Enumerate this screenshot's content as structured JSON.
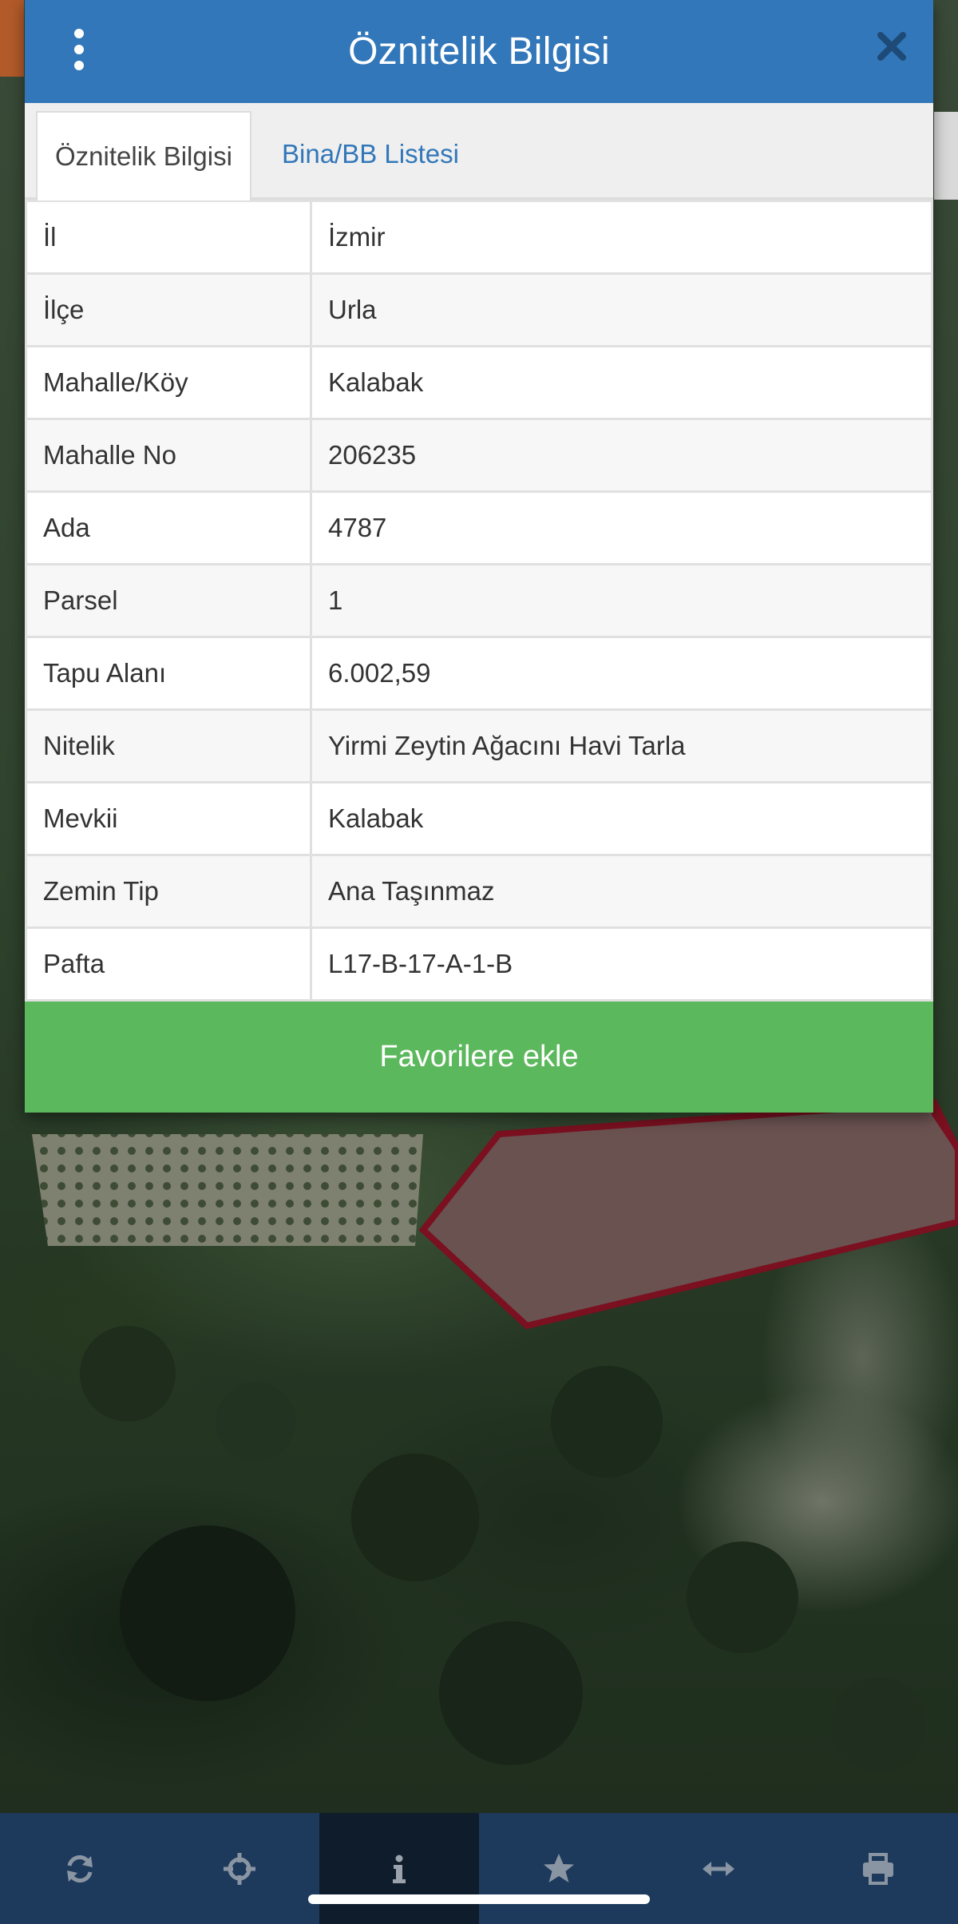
{
  "dialog": {
    "title": "Öznitelik Bilgisi",
    "tabs": [
      {
        "label": "Öznitelik Bilgisi",
        "active": true
      },
      {
        "label": "Bina/BB Listesi",
        "active": false
      }
    ],
    "rows": [
      {
        "key": "İl",
        "value": "İzmir"
      },
      {
        "key": "İlçe",
        "value": "Urla"
      },
      {
        "key": "Mahalle/Köy",
        "value": "Kalabak"
      },
      {
        "key": "Mahalle No",
        "value": "206235"
      },
      {
        "key": "Ada",
        "value": "4787"
      },
      {
        "key": "Parsel",
        "value": "1"
      },
      {
        "key": "Tapu Alanı",
        "value": "6.002,59"
      },
      {
        "key": "Nitelik",
        "value": "Yirmi Zeytin Ağacını Havi Tarla"
      },
      {
        "key": "Mevkii",
        "value": "Kalabak"
      },
      {
        "key": "Zemin Tip",
        "value": "Ana Taşınmaz"
      },
      {
        "key": "Pafta",
        "value": "L17-B-17-A-1-B"
      }
    ],
    "favorite_button": "Favorilere ekle"
  },
  "toolbar": {
    "items": [
      {
        "icon": "refresh-icon",
        "active": false
      },
      {
        "icon": "crosshair-icon",
        "active": false
      },
      {
        "icon": "info-icon",
        "active": true
      },
      {
        "icon": "star-icon",
        "active": false
      },
      {
        "icon": "measure-icon",
        "active": false
      },
      {
        "icon": "print-icon",
        "active": false
      }
    ]
  },
  "colors": {
    "header": "#3277b9",
    "tab_link": "#3277b9",
    "favorite": "#5cb85c",
    "toolbar": "#1d3a5c",
    "toolbar_active": "#0f1c2b",
    "parcel_outline": "#7a1020"
  }
}
